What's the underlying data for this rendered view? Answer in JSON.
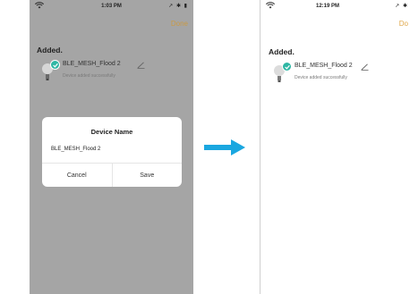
{
  "before_screen": {
    "status_time": "1:03 PM",
    "status_right": "↗ ✱ ▮",
    "done_label": "Done",
    "section_title": "Added.",
    "device": {
      "name": "BLE_MESH_Flood 2",
      "status": "Device added successfully"
    },
    "dialog": {
      "title": "Device Name",
      "field_value": "BLE_MESH_Flood 2",
      "cancel_label": "Cancel",
      "save_label": "Save"
    }
  },
  "after_screen": {
    "status_time": "12:19 PM",
    "status_right": "↗ ✱",
    "done_label": "Do",
    "section_title": "Added.",
    "device": {
      "name": "BLE_MESH_Flood 2",
      "status": "Device added successfully"
    }
  },
  "colors": {
    "accent": "#e0a84a",
    "check": "#2fb7a4",
    "arrow": "#1aa7e0",
    "overlay": "#a5a5a5"
  }
}
